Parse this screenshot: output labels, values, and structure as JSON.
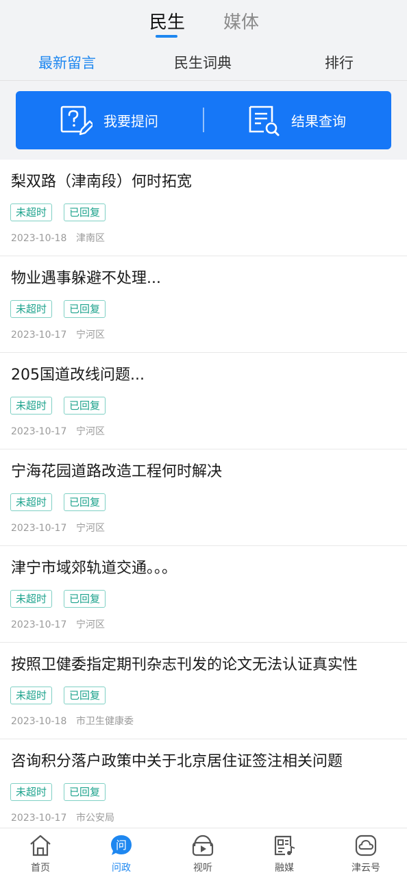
{
  "top_tabs": {
    "active": "民生",
    "inactive": "媒体"
  },
  "sub_tabs": [
    "最新留言",
    "民生词典",
    "排行"
  ],
  "actions": {
    "ask": "我要提问",
    "query": "结果查询"
  },
  "items": [
    {
      "title": "梨双路（津南段）何时拓宽",
      "tag1": "未超时",
      "tag2": "已回复",
      "date": "2023-10-18",
      "area": "津南区"
    },
    {
      "title": "物业遇事躲避不处理...",
      "tag1": "未超时",
      "tag2": "已回复",
      "date": "2023-10-17",
      "area": "宁河区"
    },
    {
      "title": "205国道改线问题...",
      "tag1": "未超时",
      "tag2": "已回复",
      "date": "2023-10-17",
      "area": "宁河区"
    },
    {
      "title": "宁海花园道路改造工程何时解决",
      "tag1": "未超时",
      "tag2": "已回复",
      "date": "2023-10-17",
      "area": "宁河区"
    },
    {
      "title": "津宁市域郊轨道交通。。。",
      "tag1": "未超时",
      "tag2": "已回复",
      "date": "2023-10-17",
      "area": "宁河区"
    },
    {
      "title": "按照卫健委指定期刊杂志刊发的论文无法认证真实性",
      "tag1": "未超时",
      "tag2": "已回复",
      "date": "2023-10-18",
      "area": "市卫生健康委"
    },
    {
      "title": "咨询积分落户政策中关于北京居住证签注相关问题",
      "tag1": "未超时",
      "tag2": "已回复",
      "date": "2023-10-17",
      "area": "市公安局"
    }
  ],
  "bottom_nav": [
    {
      "label": "首页",
      "icon": "home-icon"
    },
    {
      "label": "问政",
      "icon": "ask-politics-icon",
      "icon_text": "问"
    },
    {
      "label": "视听",
      "icon": "tv-icon"
    },
    {
      "label": "融媒",
      "icon": "newspaper-icon"
    },
    {
      "label": "津云号",
      "icon": "cloud-icon"
    }
  ],
  "colors": {
    "accent": "#1e87f0",
    "action_bar": "#1677f7",
    "tag_green": "#1ea38d"
  }
}
